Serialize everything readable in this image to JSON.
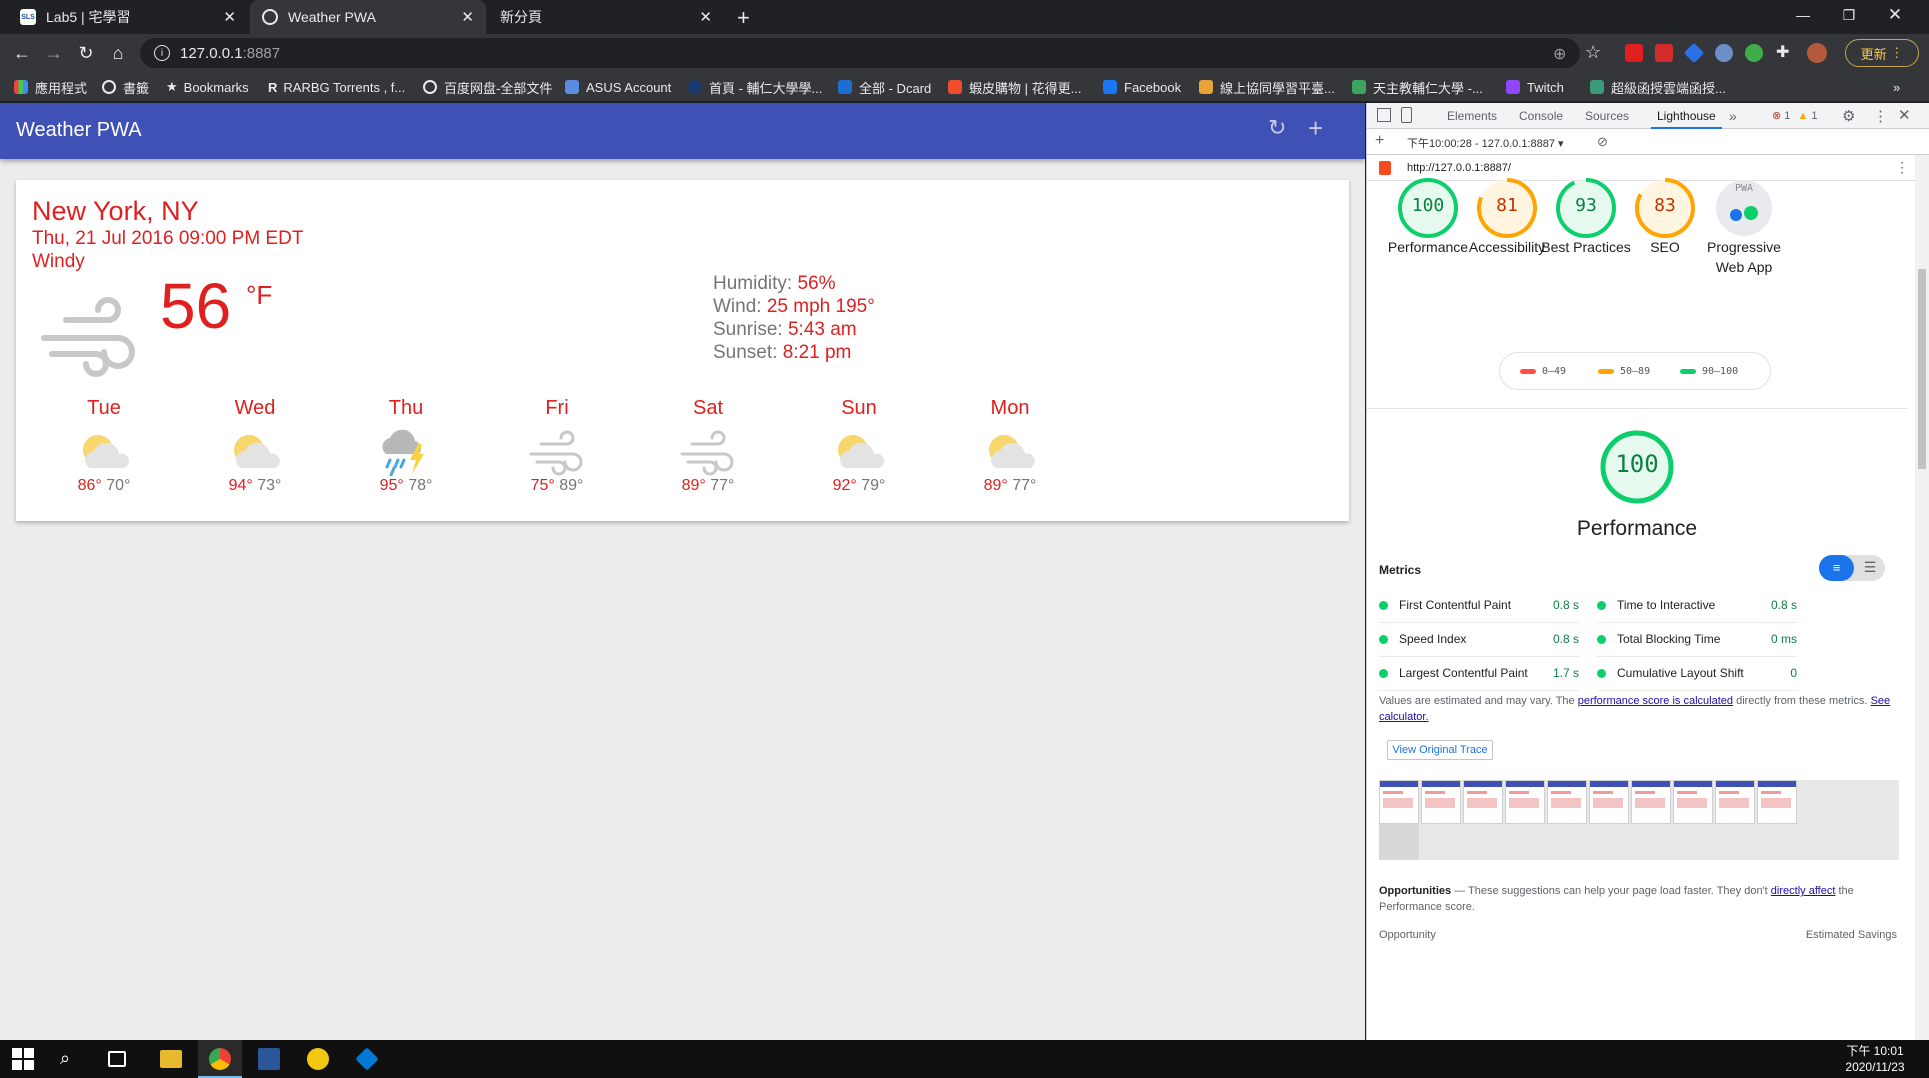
{
  "browser": {
    "tabs": [
      {
        "label": "Lab5 | 宅學習",
        "favicon_text": "SLS"
      },
      {
        "label": "Weather PWA"
      },
      {
        "label": "新分頁"
      }
    ],
    "address": {
      "host": "127.0.0.1",
      "port": ":8887"
    },
    "update_label": "更新",
    "bookmarks": [
      {
        "label": "應用程式",
        "icon": "apps-grid-icon"
      },
      {
        "label": "書籤",
        "icon": "globe-icon"
      },
      {
        "label": "Bookmarks",
        "icon": "star-icon"
      },
      {
        "label": "RARBG Torrents , f...",
        "icon": "r-icon"
      },
      {
        "label": "百度网盘-全部文件",
        "icon": "globe-icon"
      },
      {
        "label": "ASUS Account",
        "icon": "asus-icon"
      },
      {
        "label": "首頁 - 輔仁大學學...",
        "icon": "fju-icon"
      },
      {
        "label": "全部 - Dcard",
        "icon": "dcard-icon"
      },
      {
        "label": "蝦皮購物 | 花得更...",
        "icon": "shopee-icon"
      },
      {
        "label": "Facebook",
        "icon": "facebook-icon"
      },
      {
        "label": "線上協同學習平臺...",
        "icon": "learning-icon"
      },
      {
        "label": "天主教輔仁大學 -...",
        "icon": "pen-icon"
      },
      {
        "label": "Twitch",
        "icon": "twitch-icon"
      },
      {
        "label": "超級函授雲端函授...",
        "icon": "cloud-icon"
      }
    ],
    "bookmarks_more": "»"
  },
  "app": {
    "title": "Weather PWA",
    "city": "New York, NY",
    "date": "Thu, 21 Jul 2016 09:00 PM EDT",
    "description": "Windy",
    "temperature": "56",
    "unit": "°F",
    "details": [
      {
        "label": "Humidity:",
        "value": "56%"
      },
      {
        "label": "Wind:",
        "value": "25 mph 195°"
      },
      {
        "label": "Sunrise:",
        "value": "5:43 am"
      },
      {
        "label": "Sunset:",
        "value": "8:21 pm"
      }
    ],
    "forecast": [
      {
        "day": "Tue",
        "high": "86°",
        "low": "70°",
        "icon": "partly-cloudy-icon"
      },
      {
        "day": "Wed",
        "high": "94°",
        "low": "73°",
        "icon": "partly-cloudy-icon"
      },
      {
        "day": "Thu",
        "high": "95°",
        "low": "78°",
        "icon": "thunderstorm-icon"
      },
      {
        "day": "Fri",
        "high": "75°",
        "low": "89°",
        "icon": "wind-icon"
      },
      {
        "day": "Sat",
        "high": "89°",
        "low": "77°",
        "icon": "wind-icon"
      },
      {
        "day": "Sun",
        "high": "92°",
        "low": "79°",
        "icon": "partly-cloudy-icon"
      },
      {
        "day": "Mon",
        "high": "89°",
        "low": "77°",
        "icon": "partly-cloudy-icon"
      }
    ]
  },
  "devtools": {
    "tabs": [
      "Elements",
      "Console",
      "Sources",
      "Lighthouse"
    ],
    "selected_tab": "Lighthouse",
    "more": "»",
    "errors": "1",
    "warnings": "1",
    "report_select": "下午10:00:28 - 127.0.0.1:8887",
    "report_url": "http://127.0.0.1:8887/",
    "scores": [
      {
        "value": "100",
        "label": "Performance",
        "color": "#0cce6b"
      },
      {
        "value": "81",
        "label": "Accessibility",
        "color": "#ffa400"
      },
      {
        "value": "93",
        "label": "Best Practices",
        "color": "#0cce6b"
      },
      {
        "value": "83",
        "label": "SEO",
        "color": "#ffa400"
      },
      {
        "value": "",
        "label": "Progressive Web App",
        "color": "#9aa0a6",
        "badge": "PWA"
      }
    ],
    "legend": [
      {
        "range": "0–49",
        "color": "#ff4e42"
      },
      {
        "range": "50–89",
        "color": "#ffa400"
      },
      {
        "range": "90–100",
        "color": "#0cce6b"
      }
    ],
    "main_score": "100",
    "main_label": "Performance",
    "metrics_title": "Metrics",
    "metrics": [
      {
        "name": "First Contentful Paint",
        "value": "0.8 s"
      },
      {
        "name": "Time to Interactive",
        "value": "0.8 s"
      },
      {
        "name": "Speed Index",
        "value": "0.8 s"
      },
      {
        "name": "Total Blocking Time",
        "value": "0 ms"
      },
      {
        "name": "Largest Contentful Paint",
        "value": "1.7 s"
      },
      {
        "name": "Cumulative Layout Shift",
        "value": "0"
      }
    ],
    "note_prefix": "Values are estimated and may vary. The ",
    "note_link": "performance score is calculated",
    "note_suffix": " directly from these metrics. ",
    "note_link2": "See calculator.",
    "trace_button": "View Original Trace",
    "opportunities_title": "Opportunities",
    "opportunities_text_a": " — These suggestions can help your page load faster. They don't ",
    "opportunities_link": "directly affect",
    "opportunities_text_b": " the Performance score.",
    "col_opportunity": "Opportunity",
    "col_savings": "Estimated Savings"
  },
  "taskbar": {
    "time": "下午 10:01",
    "date": "2020/11/23"
  }
}
